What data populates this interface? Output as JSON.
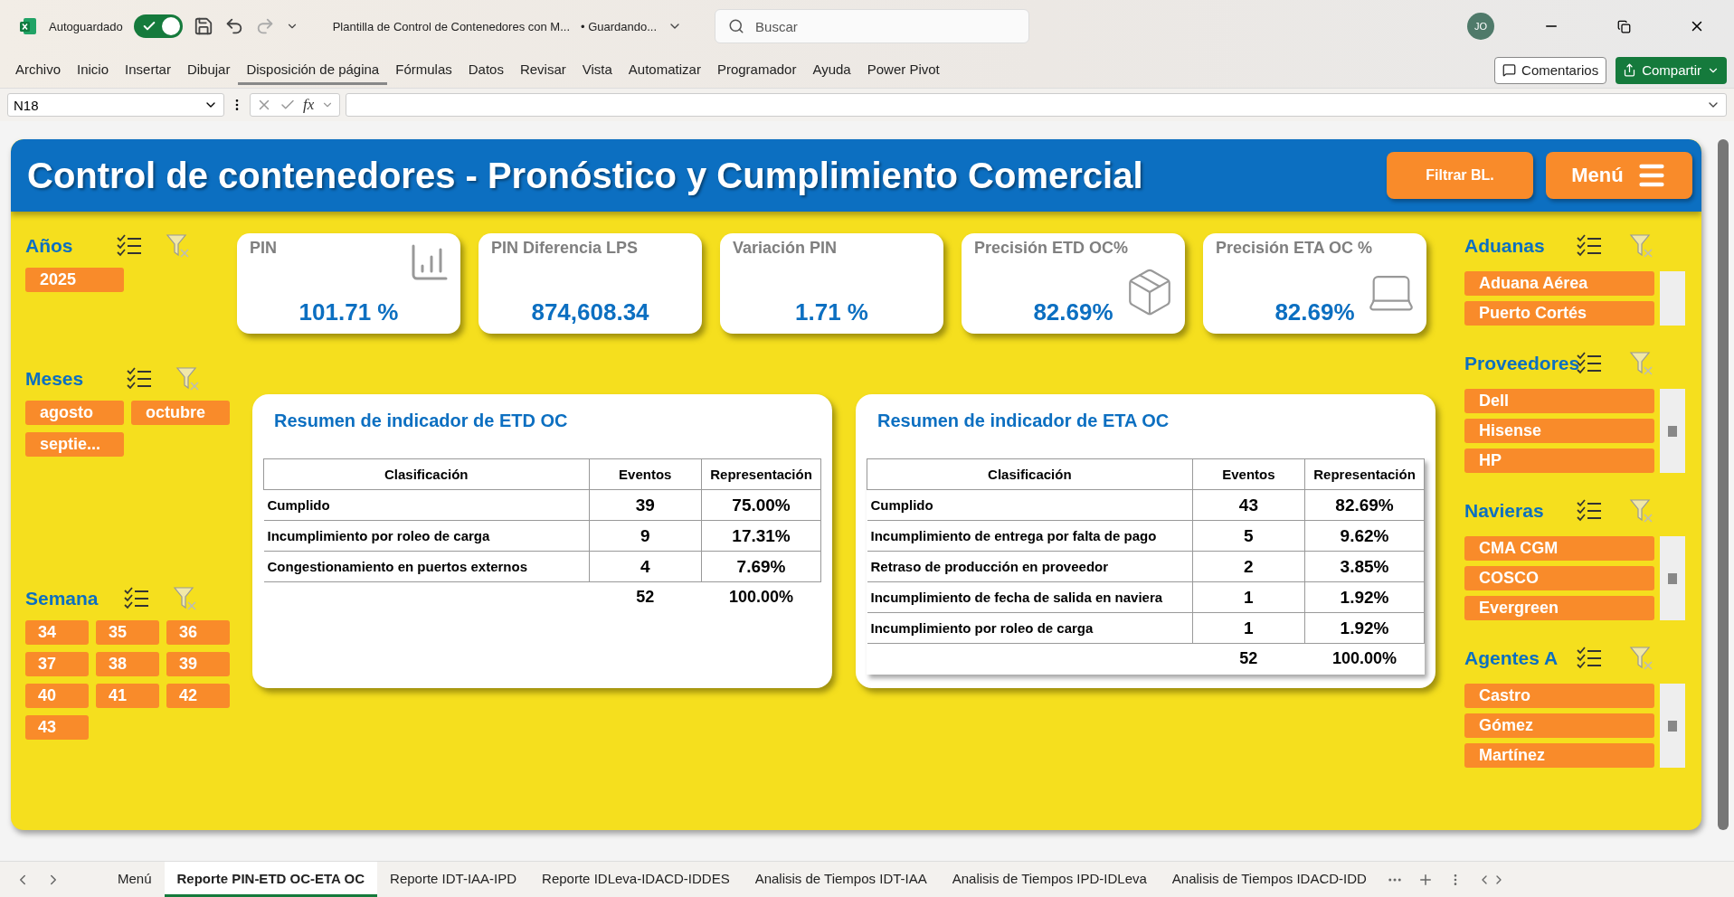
{
  "app": {
    "autosave_label": "Autoguardado",
    "autosave_on": true,
    "title": "Plantilla de Control de Contenedores con M...",
    "save_status": "• Guardando...",
    "search_placeholder": "Buscar",
    "user_initials": "JO"
  },
  "ribbon_tabs": [
    {
      "label": "Archivo",
      "selected": false
    },
    {
      "label": "Inicio",
      "selected": false
    },
    {
      "label": "Insertar",
      "selected": false
    },
    {
      "label": "Dibujar",
      "selected": false
    },
    {
      "label": "Disposición de página",
      "selected": true
    },
    {
      "label": "Fórmulas",
      "selected": false
    },
    {
      "label": "Datos",
      "selected": false
    },
    {
      "label": "Revisar",
      "selected": false
    },
    {
      "label": "Vista",
      "selected": false
    },
    {
      "label": "Automatizar",
      "selected": false
    },
    {
      "label": "Programador",
      "selected": false
    },
    {
      "label": "Ayuda",
      "selected": false
    },
    {
      "label": "Power Pivot",
      "selected": false
    }
  ],
  "ribbon_buttons": {
    "comments": "Comentarios",
    "share": "Compartir"
  },
  "formula_bar": {
    "name_box": "N18",
    "fx_label": "fx"
  },
  "dashboard": {
    "title": "Control de contenedores - Pronóstico y Cumplimiento Comercial",
    "buttons": [
      "Filtrar BL.",
      "Menú"
    ],
    "kpis": [
      {
        "label": "PIN",
        "value": "101.71 %",
        "kind": "chart"
      },
      {
        "label": "PIN Diferencia LPS",
        "value": "874,608.34",
        "kind": "none"
      },
      {
        "label": "Variación PIN",
        "value": "1.71 %",
        "kind": "none"
      },
      {
        "label": "Precisión ETD OC%",
        "value": "82.69%",
        "kind": "box"
      },
      {
        "label": "Precisión ETA OC %",
        "value": "82.69%",
        "kind": "laptop"
      }
    ],
    "left_slicers": [
      {
        "title": "Años",
        "items": [
          {
            "label": "2025",
            "selected": true
          }
        ]
      },
      {
        "title": "Meses",
        "items": [
          {
            "label": "agosto",
            "selected": true
          },
          {
            "label": "octubre",
            "selected": true
          },
          {
            "label": "septie...",
            "selected": true
          }
        ]
      },
      {
        "title": "Semana",
        "items": [
          {
            "label": "34",
            "selected": true
          },
          {
            "label": "35",
            "selected": true
          },
          {
            "label": "36",
            "selected": true
          },
          {
            "label": "37",
            "selected": true
          },
          {
            "label": "38",
            "selected": true
          },
          {
            "label": "39",
            "selected": true
          },
          {
            "label": "40",
            "selected": true
          },
          {
            "label": "41",
            "selected": true
          },
          {
            "label": "42",
            "selected": true
          },
          {
            "label": "43",
            "selected": true
          }
        ]
      }
    ],
    "right_slicers": [
      {
        "title": "Aduanas",
        "more_items": false,
        "items": [
          {
            "label": "Aduana Aérea",
            "selected": true
          },
          {
            "label": "Puerto Cortés",
            "selected": true
          }
        ]
      },
      {
        "title": "Proveedores",
        "more_items": true,
        "items": [
          {
            "label": "Dell",
            "selected": true
          },
          {
            "label": "Hisense",
            "selected": true
          },
          {
            "label": "HP",
            "selected": true
          }
        ]
      },
      {
        "title": "Navieras",
        "more_items": true,
        "items": [
          {
            "label": "CMA CGM",
            "selected": true
          },
          {
            "label": "COSCO",
            "selected": true
          },
          {
            "label": "Evergreen",
            "selected": true
          }
        ]
      },
      {
        "title": "Agentes A",
        "more_items": true,
        "items": [
          {
            "label": "Castro",
            "selected": true
          },
          {
            "label": "Gómez",
            "selected": true
          },
          {
            "label": "Martínez",
            "selected": true
          }
        ]
      }
    ],
    "tables": [
      {
        "title": "Resumen de indicador de ETD OC",
        "columns": [
          "Clasificación",
          "Eventos",
          "Representación"
        ],
        "rows": [
          [
            "Cumplido",
            "39",
            "75.00%"
          ],
          [
            "Incumplimiento por roleo de carga",
            "9",
            "17.31%"
          ],
          [
            "Congestionamiento en puertos externos",
            "4",
            "7.69%"
          ]
        ],
        "total": [
          "52",
          "100.00%"
        ]
      },
      {
        "title": "Resumen de indicador de ETA OC",
        "columns": [
          "Clasificación",
          "Eventos",
          "Representación"
        ],
        "rows": [
          [
            "Cumplido",
            "43",
            "82.69%"
          ],
          [
            "Incumplimiento de entrega por falta de pago",
            "5",
            "9.62%"
          ],
          [
            "Retraso de producción en proveedor",
            "2",
            "3.85%"
          ],
          [
            "Incumplimiento de fecha de salida en naviera",
            "1",
            "1.92%"
          ],
          [
            "Incumplimiento por roleo de carga",
            "1",
            "1.92%"
          ]
        ],
        "total": [
          "52",
          "100.00%"
        ]
      }
    ]
  },
  "sheet_tabs": [
    {
      "label": "Menú",
      "selected": false
    },
    {
      "label": "Reporte PIN-ETD OC-ETA OC",
      "selected": true
    },
    {
      "label": "Reporte IDT-IAA-IPD",
      "selected": false
    },
    {
      "label": "Reporte IDLeva-IDACD-IDDES",
      "selected": false
    },
    {
      "label": "Analisis de Tiempos IDT-IAA",
      "selected": false
    },
    {
      "label": "Analisis de Tiempos IPD-IDLeva",
      "selected": false
    },
    {
      "label": "Analisis de Tiempos IDACD-IDD",
      "selected": false
    }
  ]
}
